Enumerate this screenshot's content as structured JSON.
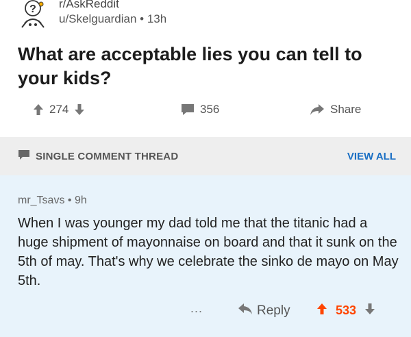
{
  "post": {
    "subreddit": "r/AskReddit",
    "author": "u/Skelguardian",
    "age": "13h",
    "title": "What are acceptable lies you can tell to your kids?",
    "upvotes": "274",
    "comments": "356",
    "share_label": "Share"
  },
  "thread_bar": {
    "label": "SINGLE COMMENT THREAD",
    "view_all": "VIEW ALL"
  },
  "comment": {
    "author": "mr_Tsavs",
    "age": "9h",
    "body": "When I was younger my dad told me that the titanic had a huge shipment of mayonnaise on board and that it sunk on the 5th of may. That's why we celebrate the sinko de mayo on May 5th.",
    "more_label": "...",
    "reply_label": "Reply",
    "score": "533"
  },
  "colors": {
    "upvote_active": "#ff4500",
    "link": "#1a6fc4",
    "comment_bg": "#e8f3fb",
    "thread_bar_bg": "#eeeeee"
  },
  "icons": {
    "subreddit": "askreddit-mascot-icon",
    "upvote": "arrow-up-icon",
    "downvote": "arrow-down-icon",
    "comments": "comment-bubble-icon",
    "share": "share-arrow-icon",
    "reply": "reply-arrow-icon"
  }
}
